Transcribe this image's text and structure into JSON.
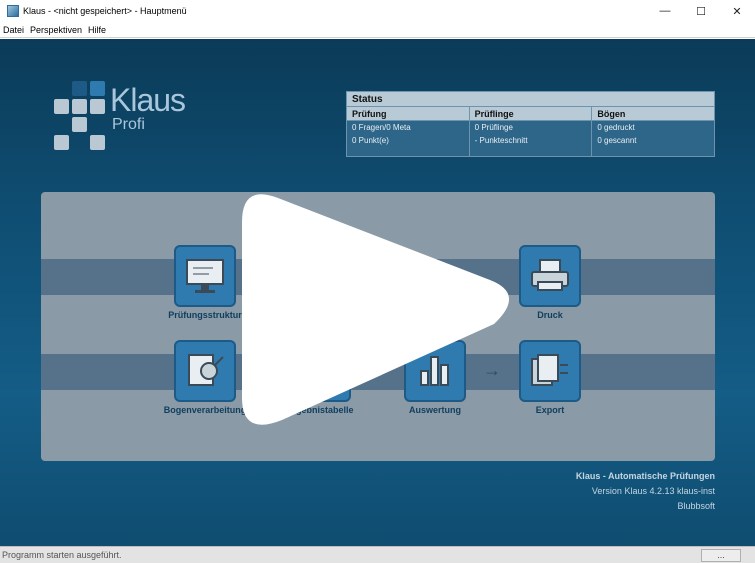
{
  "window": {
    "title": "Klaus - <nicht gespeichert> - Hauptmenü",
    "minimize_glyph": "—",
    "maximize_glyph": "☐",
    "close_glyph": "✕"
  },
  "menu": [
    "Datei",
    "Perspektiven",
    "Hilfe"
  ],
  "logo": {
    "name": "Klaus",
    "edition": "Profi"
  },
  "status": {
    "title": "Status",
    "columns": [
      {
        "header": "Prüfung",
        "values": [
          "0 Fragen/0 Meta",
          "0 Punkt(e)"
        ]
      },
      {
        "header": "Prüflinge",
        "values": [
          "0 Prüflinge",
          "- Punkteschnitt"
        ]
      },
      {
        "header": "Bögen",
        "values": [
          "0 gedruckt",
          "0 gescannt"
        ]
      }
    ]
  },
  "tiles": {
    "pruefungsstruktur": "Prüfungsstruktur",
    "druck": "Druck",
    "bogenverarbeitung": "Bogenverarbeitung",
    "ergebnistabelle": "Ergebnistabelle",
    "auswertung": "Auswertung",
    "export": "Export"
  },
  "arrow_glyph": "→",
  "info": {
    "title": "Klaus - Automatische Prüfungen",
    "version": "Version Klaus 4.2.13 klaus-inst",
    "company": "Blubbsoft"
  },
  "statusbar": {
    "message": "Programm starten ausgeführt.",
    "box": "..."
  },
  "icons": [
    "play-overlay-icon",
    "printer-icon",
    "monitor-edit-icon",
    "document-scan-icon",
    "table-edit-icon",
    "bar-chart-icon",
    "documents-export-icon"
  ]
}
